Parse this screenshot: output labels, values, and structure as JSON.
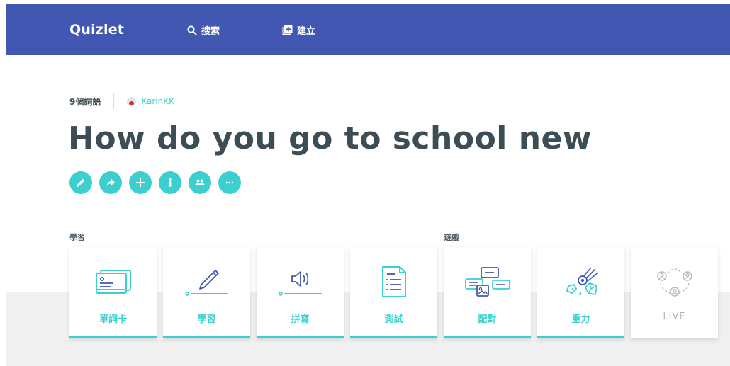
{
  "header": {
    "logo": "Quizlet",
    "search_label": "搜索",
    "create_label": "建立"
  },
  "set": {
    "term_count": "9個詞語",
    "author": "KarinKK",
    "title": "How do you go to school new"
  },
  "actions": [
    {
      "icon": "pencil-icon"
    },
    {
      "icon": "share-icon"
    },
    {
      "icon": "plus-icon"
    },
    {
      "icon": "info-icon"
    },
    {
      "icon": "people-icon"
    },
    {
      "icon": "more-icon"
    }
  ],
  "sections": {
    "study": "學習",
    "games": "遊戲"
  },
  "modes": [
    {
      "label": "單詞卡",
      "icon": "flashcards-icon",
      "enabled": true
    },
    {
      "label": "學習",
      "icon": "learn-icon",
      "enabled": true
    },
    {
      "label": "拼寫",
      "icon": "spell-icon",
      "enabled": true
    },
    {
      "label": "測試",
      "icon": "test-icon",
      "enabled": true
    },
    {
      "label": "配對",
      "icon": "match-icon",
      "enabled": true
    },
    {
      "label": "重力",
      "icon": "gravity-icon",
      "enabled": true
    },
    {
      "label": "LIVE",
      "icon": "live-icon",
      "enabled": false
    }
  ],
  "colors": {
    "header_bg": "#4257b2",
    "accent": "#3ccfcf",
    "title": "#3d4d55",
    "disabled": "#b4b8bd"
  }
}
